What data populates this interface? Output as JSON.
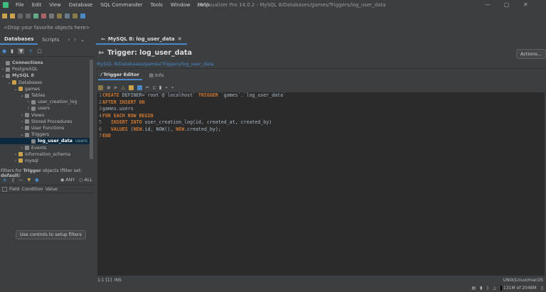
{
  "menu": [
    "File",
    "Edit",
    "View",
    "Database",
    "SQL Commander",
    "Tools",
    "Window",
    "Help"
  ],
  "window_title": "DbVisualizer Pro 14.0.2 - MySQL 8/Databases/games/Triggers/log_user_data",
  "favorites_hint": "<Drop your favorite objects here>",
  "left_tabs": [
    "Databases",
    "Scripts"
  ],
  "tree": [
    {
      "label": "Connections",
      "depth": 0,
      "bold": true
    },
    {
      "label": "PostgreSQL",
      "depth": 0,
      "chev": ">"
    },
    {
      "label": "MySQL 8",
      "depth": 0,
      "chev": "v",
      "bold": true
    },
    {
      "label": "Databases",
      "depth": 1,
      "chev": "v"
    },
    {
      "label": "games",
      "depth": 2,
      "chev": "v"
    },
    {
      "label": "Tables",
      "depth": 3,
      "chev": "v"
    },
    {
      "label": "user_creation_log",
      "depth": 4,
      "chev": ">"
    },
    {
      "label": "users",
      "depth": 4,
      "chev": ">"
    },
    {
      "label": "Views",
      "depth": 3,
      "chev": ">"
    },
    {
      "label": "Stored Procedures",
      "depth": 3,
      "chev": ">"
    },
    {
      "label": "User Functions",
      "depth": 3,
      "chev": ">"
    },
    {
      "label": "Triggers",
      "depth": 3,
      "chev": "v"
    },
    {
      "label": "log_user_data",
      "depth": 4,
      "selected": true,
      "extra": "users"
    },
    {
      "label": "Events",
      "depth": 3,
      "chev": ">"
    },
    {
      "label": "information_schema",
      "depth": 2,
      "chev": ">"
    },
    {
      "label": "mysql",
      "depth": 2,
      "chev": ">"
    }
  ],
  "filter": {
    "prefix": "Filters for ",
    "object": "Trigger",
    "mid": " objects (filter set: ",
    "set": "default",
    "suffix": ")",
    "any": "ANY",
    "all": "ALL",
    "columns": [
      "Field",
      "Condition",
      "Value"
    ],
    "setup_button": "Use controls to setup filters"
  },
  "editor_tab": "MySQL 8: log_user_data",
  "title": "Trigger: log_user_data",
  "breadcrumb": "MySQL 8/Databases/games/Triggers/log_user_data",
  "actions": "Actions...",
  "sub_tabs": [
    "Trigger Editor",
    "Info"
  ],
  "code": [
    [
      [
        "kw",
        "CREATE"
      ],
      [
        "tx",
        " DEFINER=`root`@`localhost` "
      ],
      [
        "kw",
        "TRIGGER"
      ],
      [
        "tx",
        " `games`.`log_user_data`"
      ]
    ],
    [
      [
        "kw",
        "AFTER INSERT ON"
      ]
    ],
    [
      [
        "tx",
        "games.users"
      ]
    ],
    [
      [
        "kw",
        "FOR EACH ROW BEGIN"
      ]
    ],
    [
      [
        "tx",
        "   "
      ],
      [
        "kw",
        "INSERT INTO"
      ],
      [
        "tx",
        " user_creation_log(id, created_at, created_by)"
      ]
    ],
    [
      [
        "tx",
        "   "
      ],
      [
        "kw",
        "VALUES"
      ],
      [
        "tx",
        " ("
      ],
      [
        "kw",
        "NEW"
      ],
      [
        "tx",
        ".id, NOW(), "
      ],
      [
        "kw",
        "NEW"
      ],
      [
        "tx",
        ".created_by);"
      ]
    ],
    [
      [
        "kw",
        "END"
      ]
    ]
  ],
  "status": {
    "position": "1:1 [1]",
    "mode": "INS",
    "line_ending": "UNIX/Linux/macOS",
    "memory": "131M of 2048M"
  }
}
